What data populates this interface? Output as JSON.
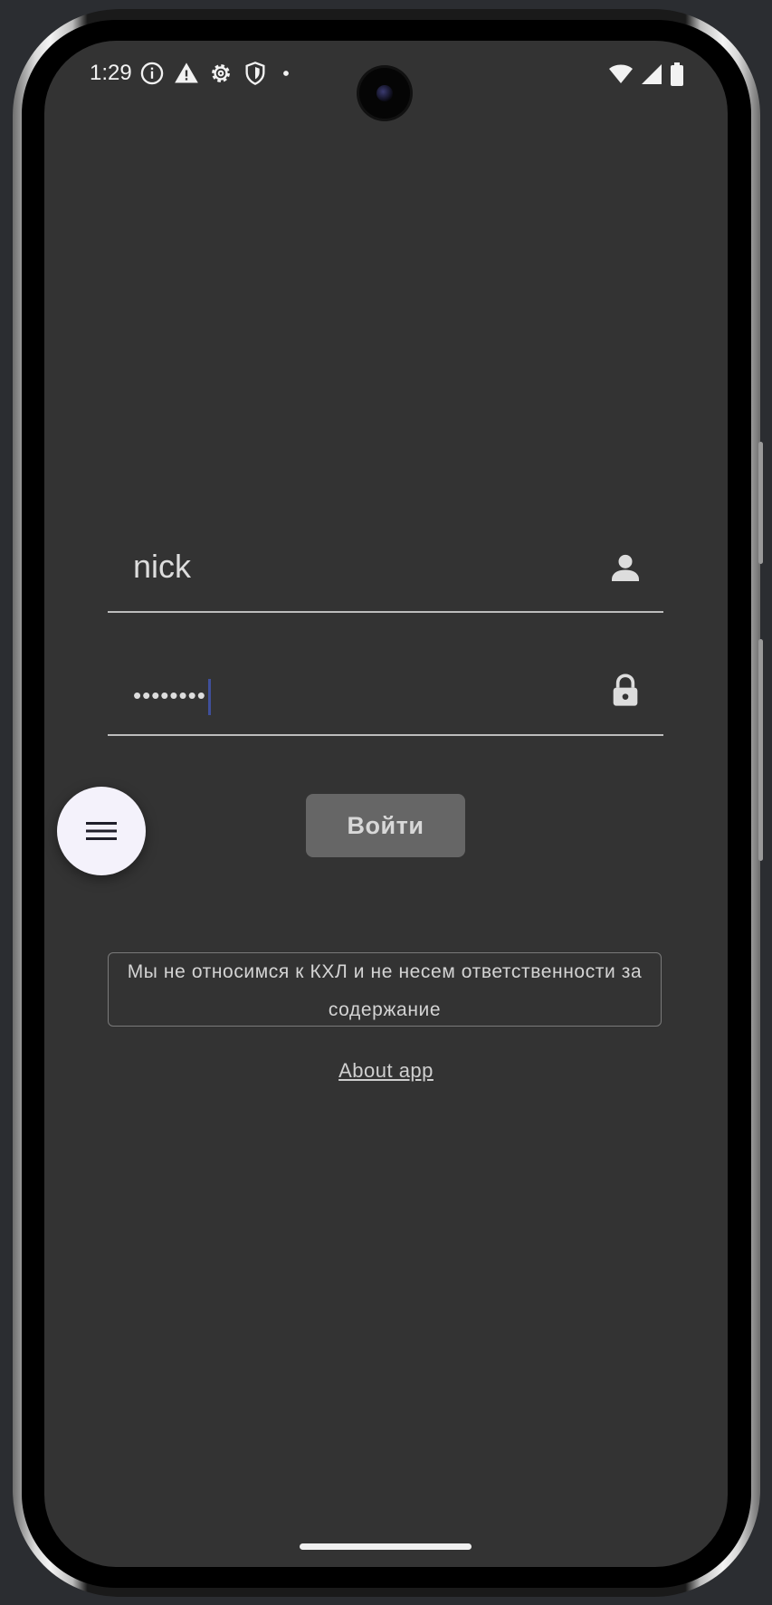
{
  "status_bar": {
    "time": "1:29",
    "left_icons": [
      "info-icon",
      "warning-icon",
      "settings-icon",
      "shield-icon",
      "dot-icon"
    ],
    "right_icons": [
      "wifi-icon",
      "signal-icon",
      "battery-icon"
    ]
  },
  "login_form": {
    "username_value": "nick",
    "password_value": "••••••••",
    "submit_label": "Войти"
  },
  "menu_fab": {
    "icon": "menu-icon"
  },
  "disclaimer": "Мы не относимся к КХЛ и не несем ответственности за содержание",
  "about_link": "About app",
  "colors": {
    "screen_background": "#333333",
    "button_background": "#666666",
    "fab_background": "#f4f2fb",
    "caret": "#3f4f9a"
  }
}
